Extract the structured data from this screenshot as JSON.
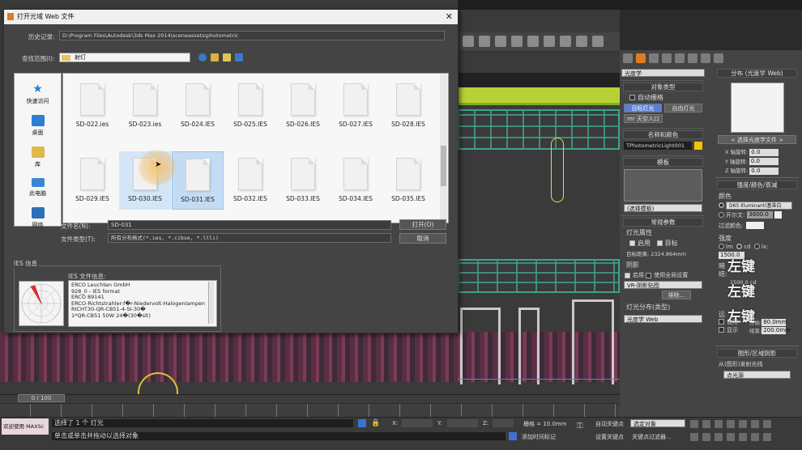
{
  "dialog": {
    "title": "打开光域 Web 文件",
    "history_label": "历史记录:",
    "history_value": "D:\\Program Files\\Autodesk\\3ds Max 2014\\sceneassets\\photometric",
    "lookin_label": "查找范围(I):",
    "lookin_value": "射灯",
    "places": [
      {
        "label": "快速访问",
        "icon": "star-icon"
      },
      {
        "label": "桌面",
        "icon": "desktop-icon"
      },
      {
        "label": "库",
        "icon": "library-icon"
      },
      {
        "label": "此电脑",
        "icon": "computer-icon"
      },
      {
        "label": "网络",
        "icon": "network-icon"
      }
    ],
    "files_row1": [
      "SD-022.ies",
      "SD-023.ies",
      "SD-024.IES",
      "SD-025.IES",
      "SD-026.IES",
      "SD-027.IES",
      "SD-028.IES"
    ],
    "files_row2": [
      "SD-029.IES",
      "SD-030.IES",
      "SD-031.IES",
      "SD-032.IES",
      "SD-033.IES",
      "SD-034.IES",
      "SD-035.IES"
    ],
    "filename_label": "文件名(N):",
    "filename_value": "SD-031",
    "filetype_label": "文件类型(T):",
    "filetype_value": "所有分布格式(*.ies, *.cibse, *.ltli)",
    "open_button": "打开(O)",
    "cancel_button": "取消",
    "ies_info_label": "IES 信息",
    "ies_file_info_label": "IES 文件信息:",
    "ies_lines": [
      "ERCO Leuchten GmbH",
      "928_0 - IES format",
      "ERCO 89141",
      "ERCO-Richtstrahler-f�r-Niedervolt-Halogenlampen",
      "RICHT30-QR-CB51-4-SI-30�",
      "1*QR-CB51 50W 24�(30�slt)"
    ]
  },
  "right_panel": {
    "tab_colors": {
      "active": "#e07b1f",
      "inactive": "#7c7c7c"
    },
    "category_dropdown": "光度学",
    "object_type_header": "对象类型",
    "autogrid": "自动栅格",
    "target_light": "目标灯光",
    "free_light": "自由灯光",
    "sky_portal": "mr 天空入口",
    "name_color_header": "名称和颜色",
    "light_name": "TPhotometricLight001",
    "name_swatch_color": "#f2c200",
    "template_header": "模板",
    "template_dropdown": "(选择模板)",
    "general_header": "常规参数",
    "light_props": "灯光属性",
    "enable": "启用",
    "target": "目标",
    "target_distance_label": "目标距离:",
    "target_distance_value": "2324.864mm",
    "shadows": "阴影",
    "shadows_enable": "启用",
    "global_settings": "使用全局设置",
    "shadow_type": "VR-阴影贴图",
    "exclude_button": "排除...",
    "distribution_label": "灯光分布(类型)",
    "distribution_value": "光度学 Web"
  },
  "web_panel": {
    "header": "分布 (光度学 Web)",
    "choose_file": "< 选择光度学文件 >",
    "x_rot_label": "X 轴旋转:",
    "x_rot": "0.0",
    "y_rot_label": "Y 轴旋转:",
    "y_rot": "0.0",
    "z_rot_label": "Z 轴旋转:",
    "z_rot": "0.0",
    "intensity_header": "强度/颜色/衰减",
    "color_label": "颜色",
    "d65": "D65 Illuminant(基准白",
    "kelvin_label": "开尔文:",
    "kelvin_value": "3600.0",
    "filter_label": "过滤颜色:",
    "strength_label": "强度",
    "units": [
      "lm",
      "cd",
      "lx:"
    ],
    "intensity_value": "1500.0",
    "dimming_label": "暗",
    "dim_partial": "结:",
    "dim_value": "1500.0 cd",
    "watermarks": [
      "左键",
      "左键",
      "左键"
    ],
    "far_label1": "远",
    "far_label2": "使用",
    "display_label": "显示",
    "start_label": "开始:",
    "start_value": "80.0mm",
    "end_label": "结束:",
    "end_value": "200.0mm",
    "shape_header": "图形/区域阴影",
    "emit_label": "从(图形)发射光线",
    "emit_value": "点光源"
  },
  "timeline": {
    "frame": "0 / 100"
  },
  "status": {
    "welcome": "欢迎使用 MAXSc",
    "selected": "选择了 1 个 灯光",
    "hint": "单击或单击并拖动以选择对象",
    "x_label": "X:",
    "y_label": "Y:",
    "z_label": "Z:",
    "grid": "栅格 = 10.0mm",
    "auto_key": "自动关键点",
    "selected_obj": "选定对象",
    "set_key": "设置关键点",
    "key_filters": "关键点过滤器...",
    "add_time_tag": "添加时间标记"
  }
}
